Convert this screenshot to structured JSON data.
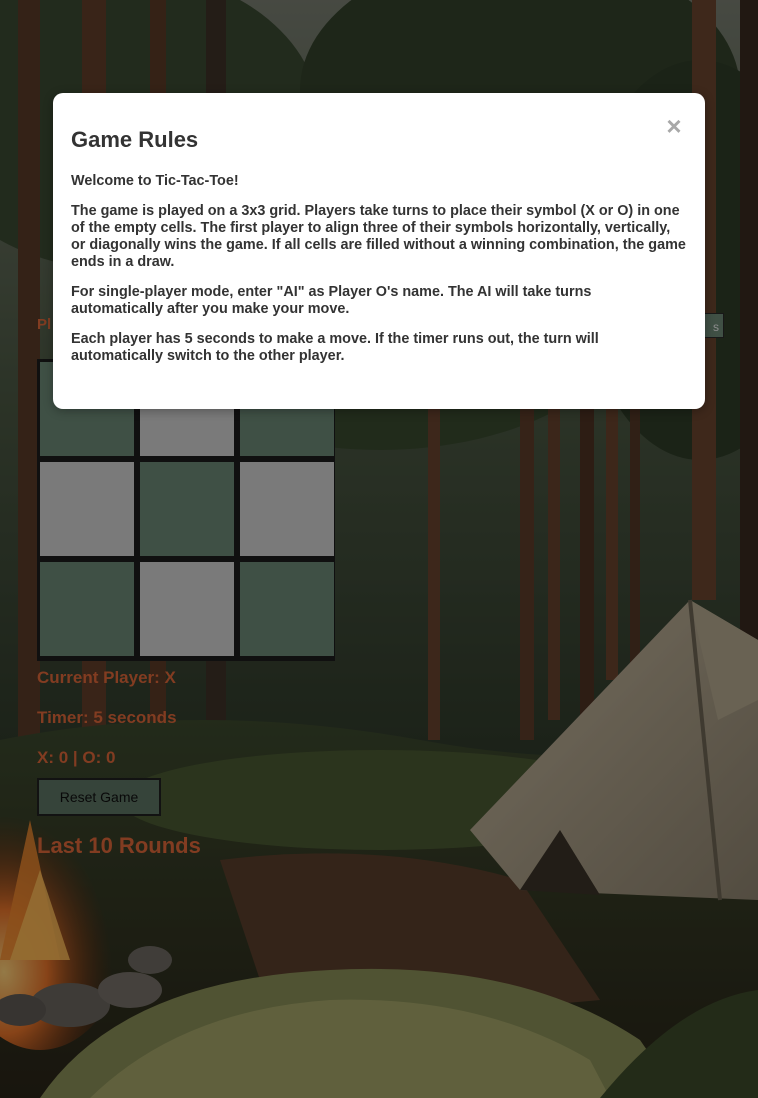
{
  "page": {
    "player_label": "Pl",
    "corner_button_label": "s"
  },
  "board": {
    "cells": [
      {
        "mark": "",
        "shade": "green"
      },
      {
        "mark": "",
        "shade": "grey"
      },
      {
        "mark": "",
        "shade": "green"
      },
      {
        "mark": "",
        "shade": "grey"
      },
      {
        "mark": "",
        "shade": "green"
      },
      {
        "mark": "",
        "shade": "grey"
      },
      {
        "mark": "",
        "shade": "green"
      },
      {
        "mark": "",
        "shade": "grey"
      },
      {
        "mark": "",
        "shade": "green"
      }
    ]
  },
  "status": {
    "current_player": "Current Player: X",
    "timer": "Timer: 5 seconds",
    "score": "X: 0 | O: 0"
  },
  "controls": {
    "reset_label": "Reset Game"
  },
  "history": {
    "heading": "Last 10 Rounds"
  },
  "modal": {
    "title": "Game Rules",
    "close_symbol": "×",
    "welcome": "Welcome to Tic-Tac-Toe!",
    "rules": "The game is played on a 3x3 grid. Players take turns to place their symbol (X or O) in one of the empty cells. The first player to align three of their symbols horizontally, vertically, or diagonally wins the game. If all cells are filled without a winning combination, the game ends in a draw.",
    "ai_mode": "For single-player mode, enter \"AI\" as Player O's name. The AI will take turns automatically after you make your move.",
    "timer_rule": "Each player has 5 seconds to make a move. If the timer runs out, the turn will automatically switch to the other player."
  },
  "colors": {
    "accent": "#e0683a",
    "cell_green": "#6d8b77",
    "cell_grey": "#d2d2d2",
    "button_bg": "#5d7565"
  },
  "icons": {
    "close": "close-icon"
  }
}
